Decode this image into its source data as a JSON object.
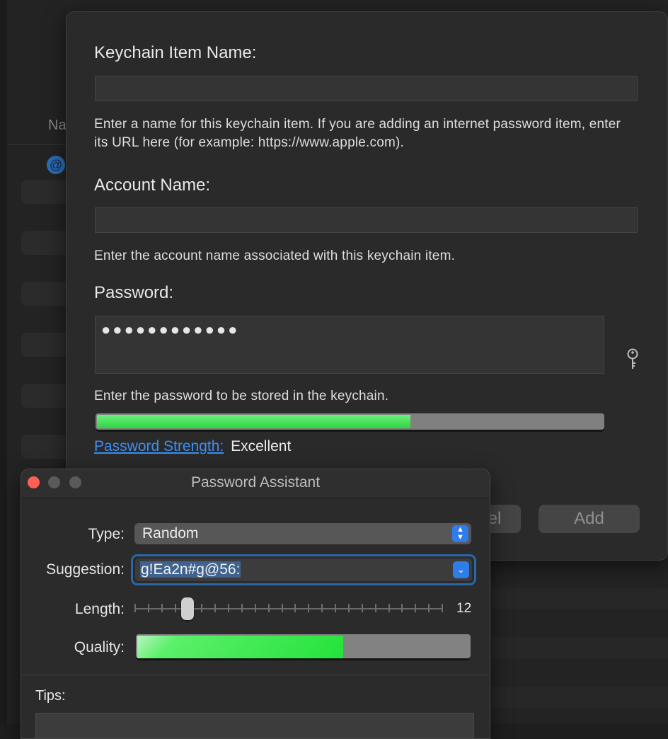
{
  "background": {
    "column_header": "Na",
    "item_icon": "at-icon"
  },
  "sheet": {
    "item_name_label": "Keychain Item Name:",
    "item_name_value": "",
    "item_name_help": "Enter a name for this keychain item. If you are adding an internet password item, enter its URL here (for example: https://www.apple.com).",
    "account_label": "Account Name:",
    "account_value": "",
    "account_help": "Enter the account name associated with this keychain item.",
    "password_label": "Password:",
    "password_masked": "●●●●●●●●●●●●",
    "password_help": "Enter the password to be stored in the keychain.",
    "strength_fraction": 0.62,
    "strength_link": "Password Strength:",
    "strength_value": "Excellent",
    "cancel_label": "el",
    "add_label": "Add"
  },
  "assistant": {
    "title": "Password Assistant",
    "type_label": "Type:",
    "type_value": "Random",
    "suggestion_label": "Suggestion:",
    "suggestion_value": "g!Ea2n#g@56:",
    "length_label": "Length:",
    "length_value": "12",
    "length_min": 8,
    "length_max": 31,
    "quality_label": "Quality:",
    "quality_fraction": 0.62,
    "tips_label": "Tips:"
  },
  "colors": {
    "accent": "#2f7dea",
    "link": "#3d8ef0",
    "strength_green": "#2fd445",
    "close_red": "#fe5f57"
  }
}
